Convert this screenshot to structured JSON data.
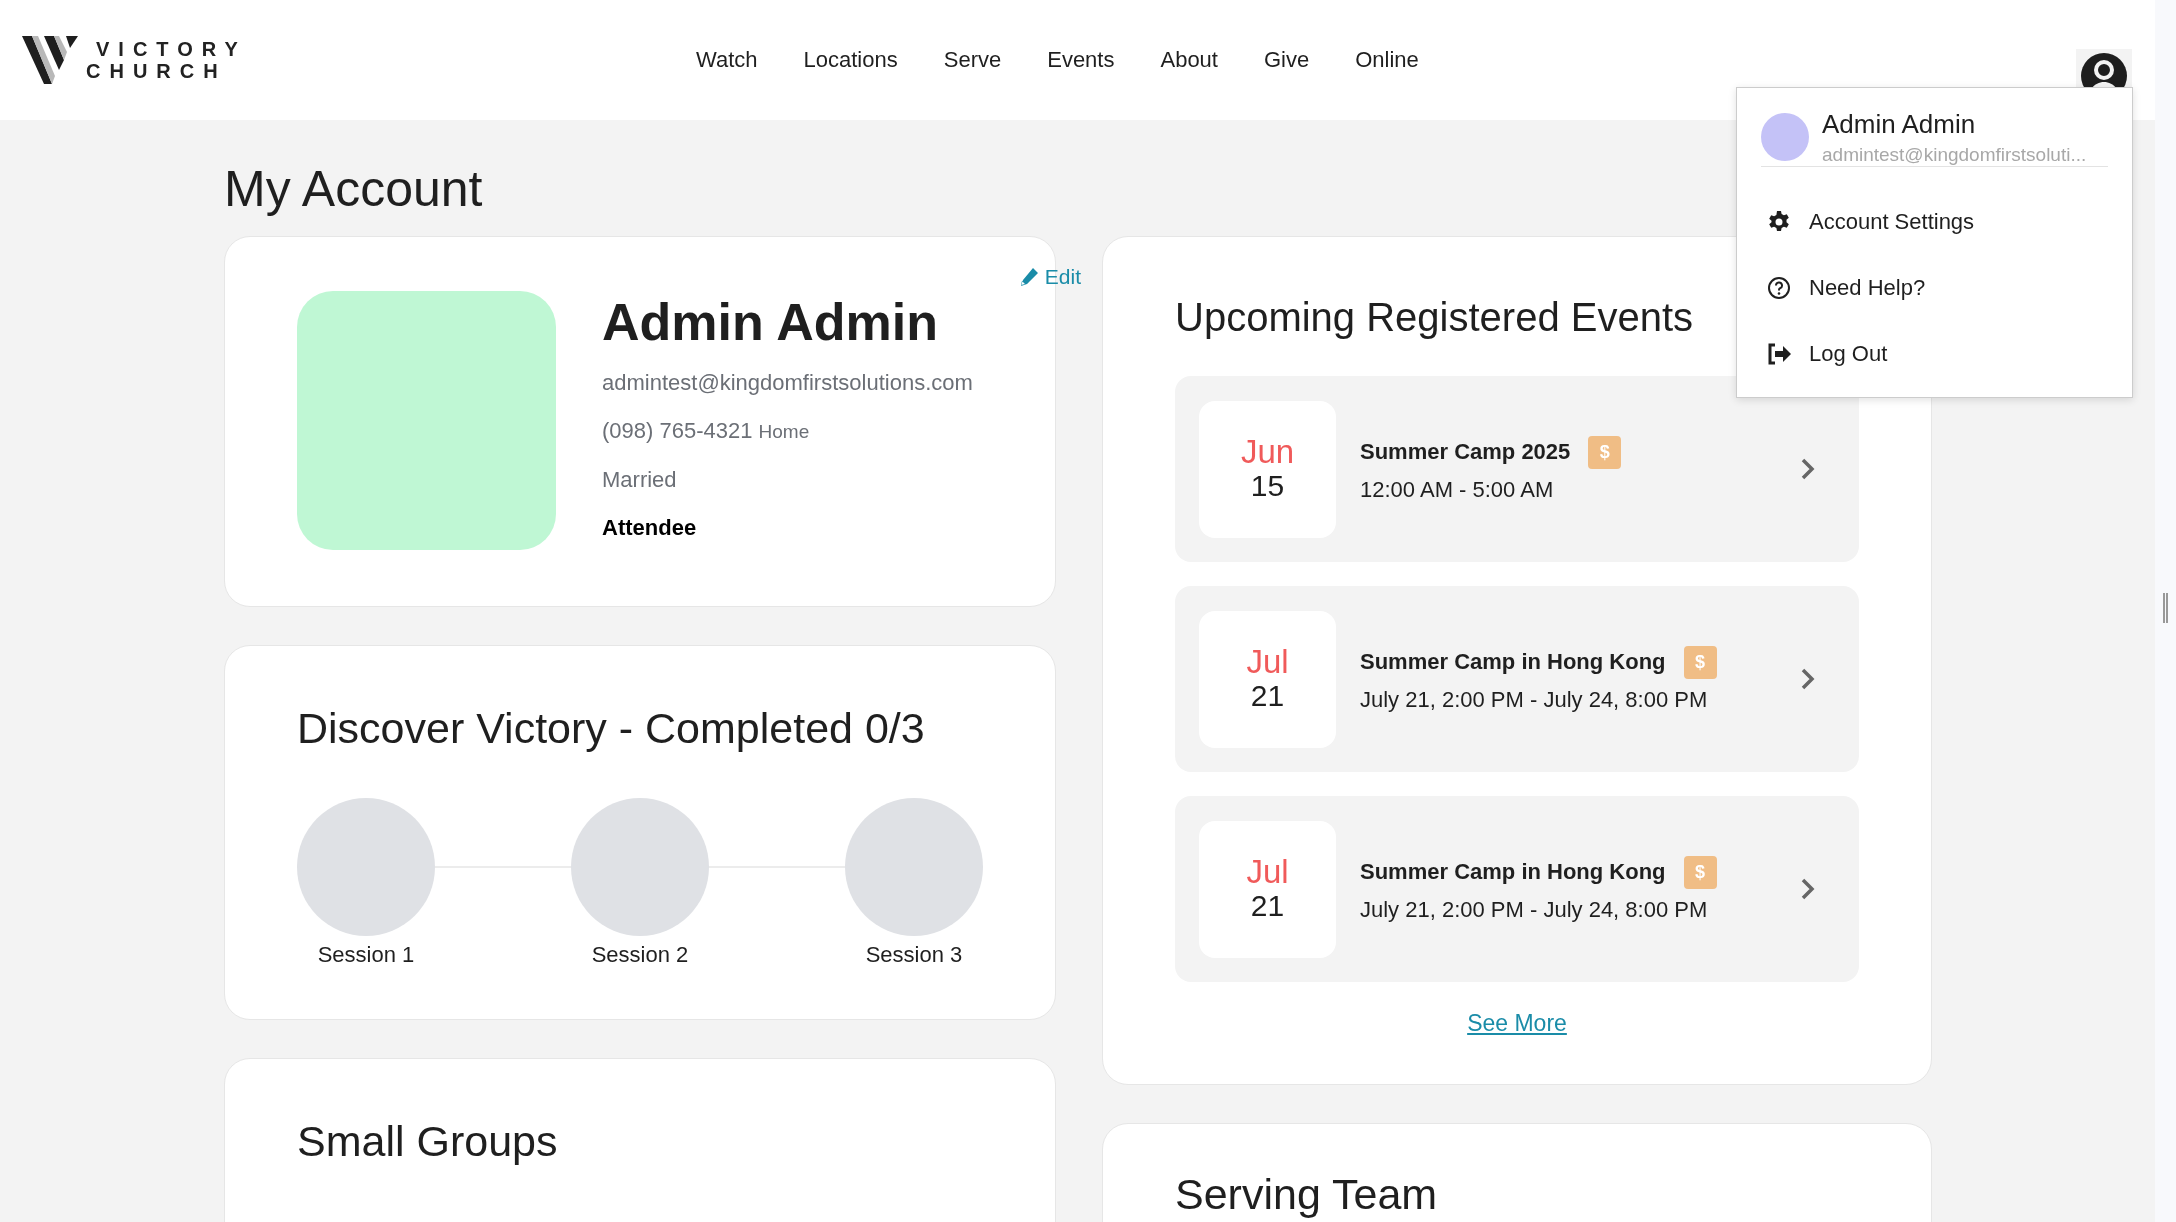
{
  "header": {
    "logo": {
      "line1": "VICTORY",
      "line2": "CHURCH"
    },
    "nav": [
      "Watch",
      "Locations",
      "Serve",
      "Events",
      "About",
      "Give",
      "Online"
    ]
  },
  "page_title": "My Account",
  "profile": {
    "edit": "Edit",
    "name": "Admin Admin",
    "email": "admintest@kingdomfirstsolutions.com",
    "phone": "(098) 765-4321",
    "phone_type": "Home",
    "marital_status": "Married",
    "role": "Attendee"
  },
  "discover": {
    "title": "Discover Victory - Completed 0/3",
    "sessions": [
      {
        "label": "Session 1",
        "completed": false
      },
      {
        "label": "Session 2",
        "completed": false
      },
      {
        "label": "Session 3",
        "completed": false
      }
    ]
  },
  "small_groups": {
    "title": "Small Groups"
  },
  "events": {
    "title": "Upcoming Registered Events",
    "items": [
      {
        "month": "Jun",
        "day": "15",
        "title": "Summer Camp 2025",
        "time": "12:00 AM - 5:00 AM",
        "badge": "$"
      },
      {
        "month": "Jul",
        "day": "21",
        "title": "Summer Camp in Hong Kong",
        "time": "July 21, 2:00 PM - July 24, 8:00 PM",
        "badge": "$"
      },
      {
        "month": "Jul",
        "day": "21",
        "title": "Summer Camp in Hong Kong",
        "time": "July 21, 2:00 PM - July 24, 8:00 PM",
        "badge": "$"
      }
    ],
    "see_more": "See More"
  },
  "serving_team": {
    "title": "Serving Team"
  },
  "account_menu": {
    "name": "Admin Admin",
    "email": "admintest@kingdomfirstsoluti...",
    "items": [
      {
        "kind": "settings",
        "label": "Account Settings"
      },
      {
        "kind": "help",
        "label": "Need Help?"
      },
      {
        "kind": "logout",
        "label": "Log Out"
      }
    ]
  }
}
